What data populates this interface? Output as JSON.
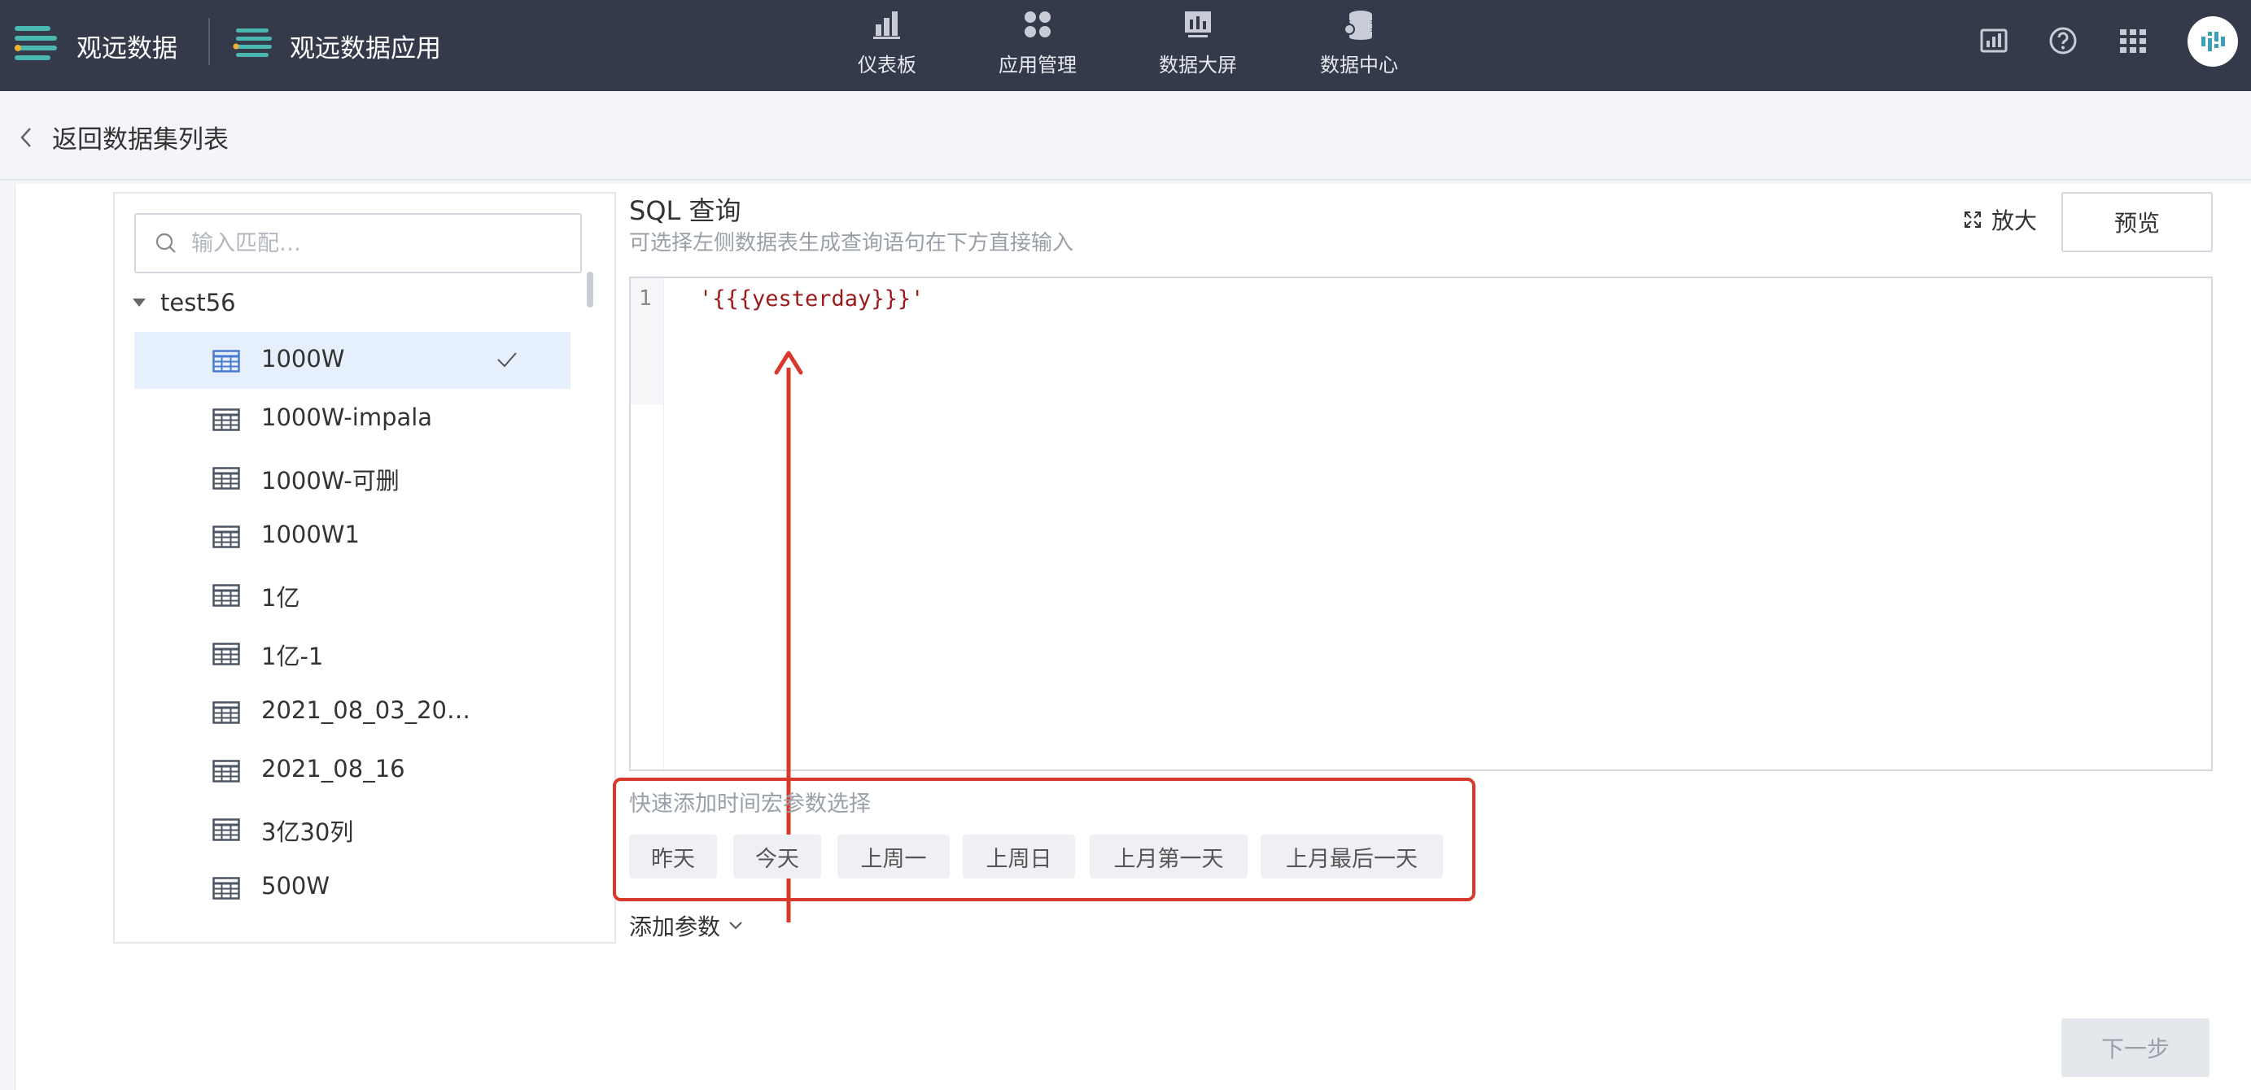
{
  "header": {
    "brand_primary": "观远数据",
    "brand_secondary": "观远数据应用",
    "nav": [
      {
        "label": "仪表板",
        "icon": "bar-chart-icon"
      },
      {
        "label": "应用管理",
        "icon": "apps-grid-icon"
      },
      {
        "label": "数据大屏",
        "icon": "screen-icon"
      },
      {
        "label": "数据中心",
        "icon": "database-icon"
      }
    ],
    "right_icons": [
      "report-icon",
      "help-icon",
      "grid-menu-icon",
      "user-avatar-icon"
    ]
  },
  "subheader": {
    "back_label": "返回数据集列表"
  },
  "left_panel": {
    "search_placeholder": "输入匹配…",
    "folder": "test56",
    "tables": [
      {
        "label": "1000W",
        "selected": true
      },
      {
        "label": "1000W-impala"
      },
      {
        "label": "1000W-可删"
      },
      {
        "label": "1000W1"
      },
      {
        "label": "1亿"
      },
      {
        "label": "1亿-1"
      },
      {
        "label": "2021_08_03_20…"
      },
      {
        "label": "2021_08_16"
      },
      {
        "label": "3亿30列"
      },
      {
        "label": "500W"
      }
    ]
  },
  "sql": {
    "title": "SQL 查询",
    "subtitle": "可选择左侧数据表生成查询语句在下方直接输入",
    "zoom_label": "放大",
    "preview_label": "预览",
    "line_number": "1",
    "code": "'{{{yesterday}}}'"
  },
  "macros": {
    "title": "快速添加时间宏参数选择",
    "chips": [
      "昨天",
      "今天",
      "上周一",
      "上周日",
      "上月第一天",
      "上月最后一天"
    ]
  },
  "add_param_label": "添加参数",
  "next_label": "下一步",
  "colors": {
    "topbar": "#343a4a",
    "brand_teal": "#4ab8b0",
    "selected_bg": "#e6f0fc",
    "table_icon": "#4b5563",
    "annotation_red": "#d9382c",
    "code_string": "#9b1b1b"
  }
}
